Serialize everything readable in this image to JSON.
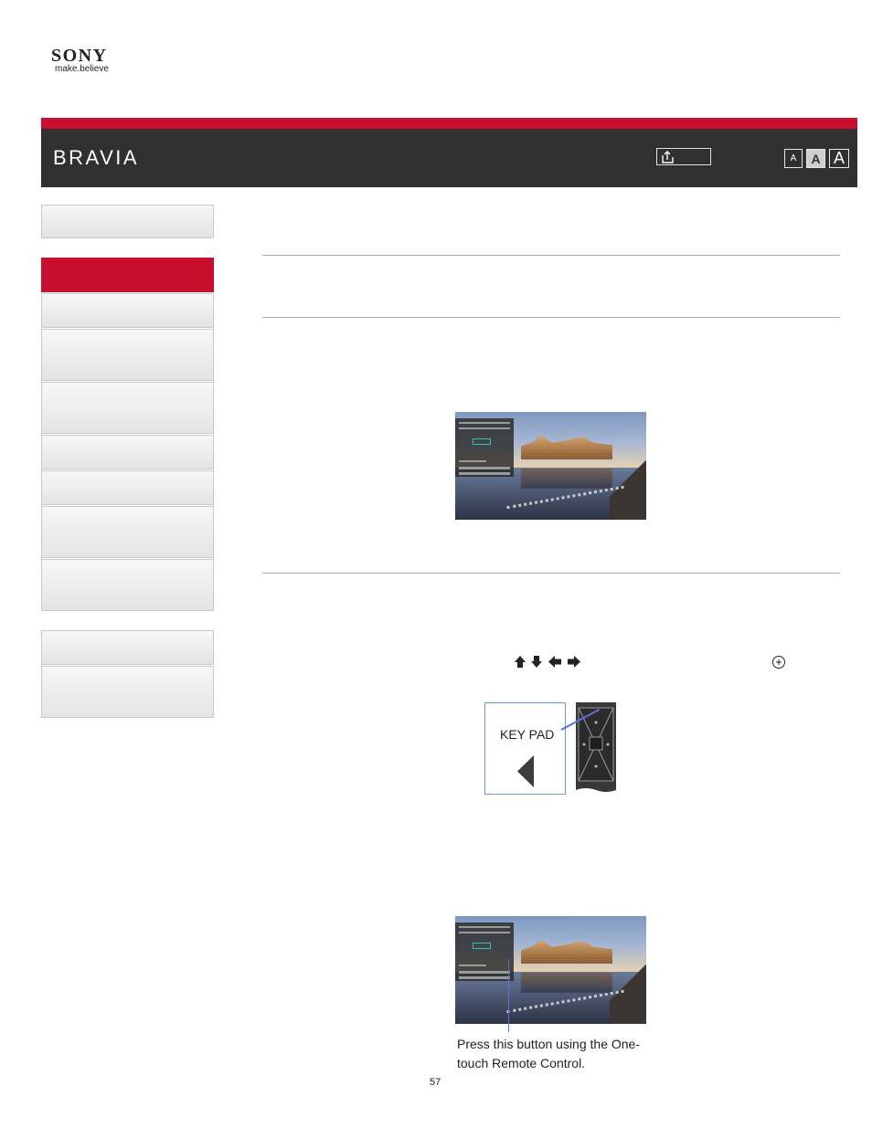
{
  "brand": {
    "logo": "SONY",
    "tagline": "make.believe"
  },
  "header": {
    "product": "BRAVIA",
    "font_size_buttons": [
      "A",
      "A",
      "A"
    ],
    "print_icon": "print-icon",
    "accent_color": "#c8102e"
  },
  "sidebar": {
    "active_color": "#c8102e",
    "items": [
      {
        "label": "",
        "active": false
      },
      {
        "label": "",
        "active": true
      },
      {
        "label": "",
        "active": false
      },
      {
        "label": "",
        "active": false
      },
      {
        "label": "",
        "active": false
      },
      {
        "label": "",
        "active": false
      },
      {
        "label": "",
        "active": false
      },
      {
        "label": "",
        "active": false
      },
      {
        "label": "",
        "active": false
      },
      {
        "label": "",
        "active": false
      },
      {
        "label": "",
        "active": false
      }
    ]
  },
  "content": {
    "arrow_keys_icon": "arrow-keys-icon",
    "enter_icon": "enter-circle-icon",
    "keypad_illustration": {
      "label": "KEY PAD"
    },
    "caption": "Press this button using the One-touch Remote Control."
  },
  "page_number": "57"
}
